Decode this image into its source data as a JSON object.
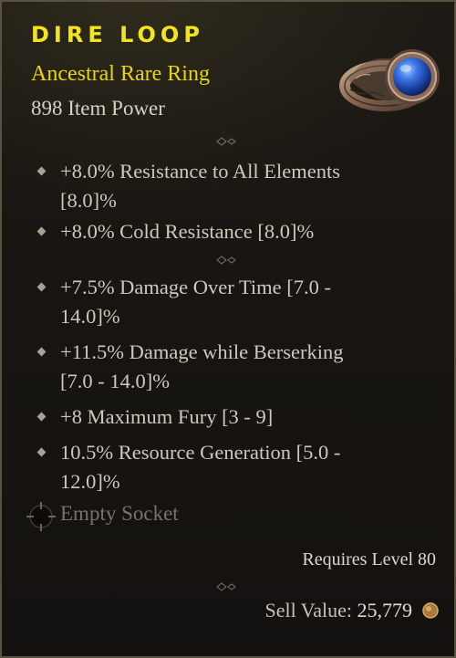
{
  "item": {
    "name": "DIRE LOOP",
    "rarity": "Ancestral Rare Ring",
    "item_power": "898 Item Power",
    "icon": "ring-icon"
  },
  "implicits": [
    {
      "text_line1": "+8.0% Resistance to All Elements",
      "text_line2": "[8.0]%"
    },
    {
      "text_line1": "+8.0% Cold Resistance [8.0]%"
    }
  ],
  "affixes": [
    {
      "text_line1": "+7.5% Damage Over Time [7.0 -",
      "text_line2": "14.0]%"
    },
    {
      "text_line1": "+11.5% Damage while Berserking",
      "text_line2": "[7.0 - 14.0]%"
    },
    {
      "text_line1": "+8 Maximum Fury [3 - 9]"
    },
    {
      "text_line1": "10.5% Resource Generation [5.0 -",
      "text_line2": "12.0]%"
    }
  ],
  "socket": {
    "label": "Empty Socket",
    "icon": "empty-socket-icon"
  },
  "requirements": {
    "level_text": "Requires Level 80"
  },
  "sell": {
    "label": "Sell Value:",
    "value": "25,779",
    "icon": "gold-coin-icon"
  },
  "colors": {
    "rare_yellow": "#f2e41e",
    "body_text": "#cfc9bc",
    "muted_text": "#77736b",
    "border": "#58533f",
    "gem_blue": "#2f63d6"
  }
}
